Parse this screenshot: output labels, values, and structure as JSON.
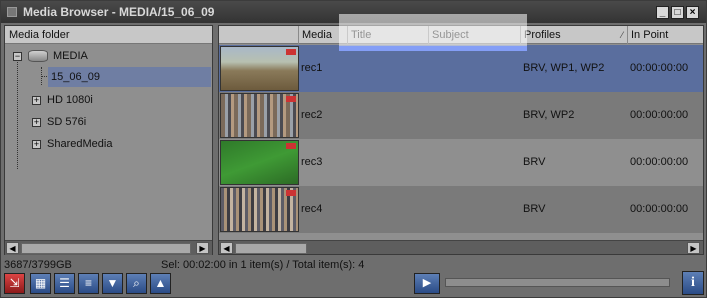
{
  "window": {
    "title": "Media Browser - MEDIA/15_06_09"
  },
  "left_panel": {
    "header": "Media folder",
    "tree": [
      {
        "label": "MEDIA"
      },
      {
        "label": "15_06_09"
      },
      {
        "label": "HD 1080i"
      },
      {
        "label": "SD 576i"
      },
      {
        "label": "SharedMedia"
      }
    ]
  },
  "table": {
    "columns": [
      "Media",
      "Title",
      "Subject",
      "Profiles",
      "In Point"
    ],
    "rows": [
      {
        "media": "rec1",
        "profiles": "BRV, WP1, WP2",
        "in_point": "00:00:00:00"
      },
      {
        "media": "rec2",
        "profiles": "BRV, WP2",
        "in_point": "00:00:00:00"
      },
      {
        "media": "rec3",
        "profiles": "BRV",
        "in_point": "00:00:00:00"
      },
      {
        "media": "rec4",
        "profiles": "BRV",
        "in_point": "00:00:00:00"
      }
    ]
  },
  "status": {
    "disk": "3687/3799GB",
    "selection": "Sel: 00:02:00 in 1 item(s) / Total item(s): 4"
  },
  "colors": {
    "selected_row": "#5a6e9e",
    "row_alt": "#7a7a7a",
    "accent": "#2a4b86"
  },
  "icons": {
    "toolbar": [
      "import-icon",
      "grid-view-icon",
      "list-view-icon",
      "details-view-icon",
      "filter-icon",
      "search-icon",
      "thumbnail-icon"
    ],
    "playback": "play-icon",
    "info": "info-icon"
  }
}
